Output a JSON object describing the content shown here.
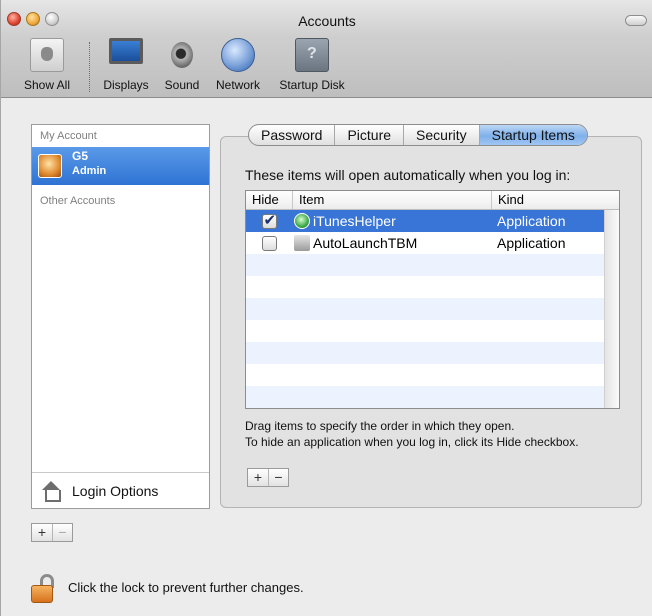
{
  "window": {
    "title": "Accounts"
  },
  "toolbar": {
    "items": [
      {
        "label": "Show All",
        "icon": "show-all-icon"
      },
      {
        "label": "Displays",
        "icon": "displays-icon"
      },
      {
        "label": "Sound",
        "icon": "sound-icon"
      },
      {
        "label": "Network",
        "icon": "network-icon"
      },
      {
        "label": "Startup Disk",
        "icon": "startup-disk-icon"
      }
    ]
  },
  "sidebar": {
    "my_account_header": "My Account",
    "selected_account": {
      "name": "G5",
      "role": "Admin"
    },
    "other_accounts_header": "Other Accounts",
    "login_options_label": "Login Options",
    "add_label": "+",
    "remove_label": "−"
  },
  "tabs": [
    "Password",
    "Picture",
    "Security",
    "Startup Items"
  ],
  "active_tab": "Startup Items",
  "startup": {
    "intro": "These items will open automatically when you log in:",
    "columns": [
      "Hide",
      "Item",
      "Kind"
    ],
    "rows": [
      {
        "hide": true,
        "item": "iTunesHelper",
        "kind": "Application",
        "selected": true
      },
      {
        "hide": false,
        "item": "AutoLaunchTBM",
        "kind": "Application",
        "selected": false
      }
    ],
    "help_line1": "Drag items to specify the order in which they open.",
    "help_line2": "To hide an application when you log in, click its Hide checkbox.",
    "add_label": "+",
    "remove_label": "−"
  },
  "lock": {
    "text": "Click the lock to prevent further changes."
  }
}
